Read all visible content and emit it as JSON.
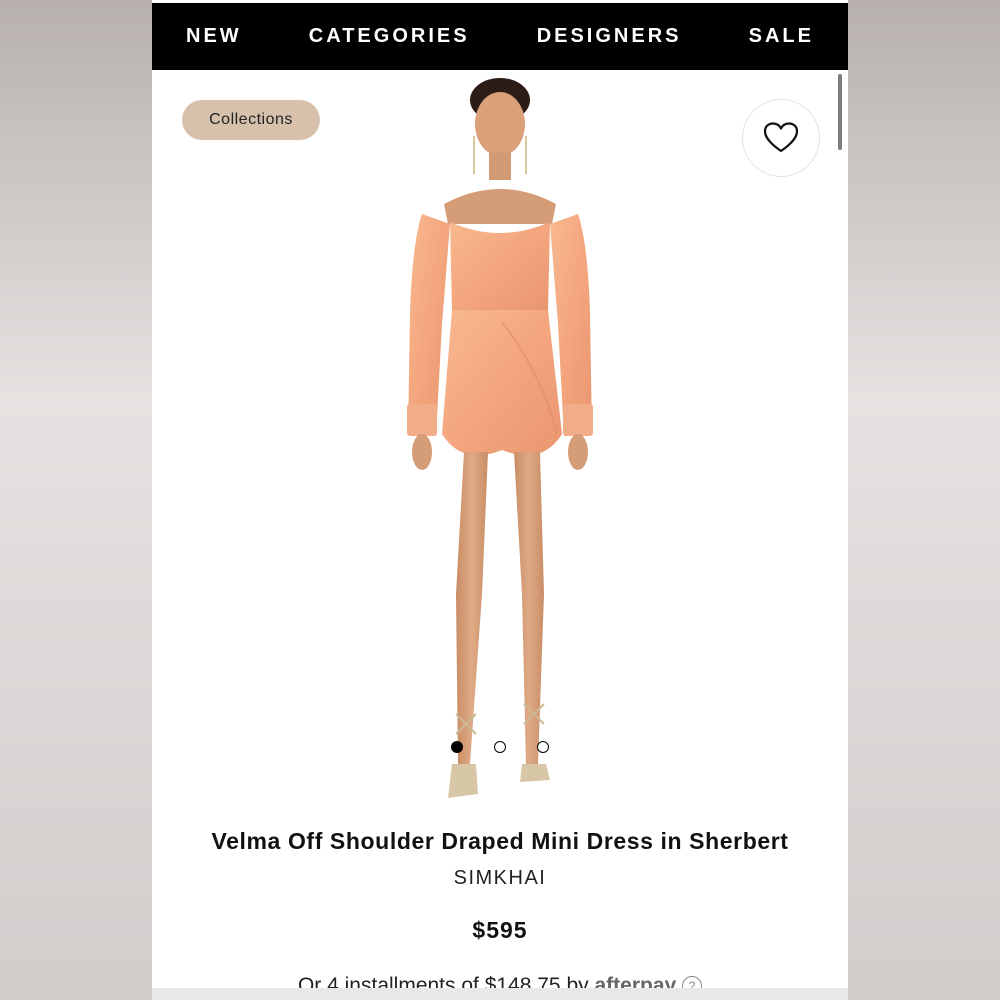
{
  "nav": {
    "items": [
      "NEW",
      "CATEGORIES",
      "DESIGNERS",
      "SALE"
    ]
  },
  "badge": {
    "label": "Collections"
  },
  "wishlist": {
    "icon": "heart-icon"
  },
  "carousel": {
    "count": 3,
    "active_index": 0
  },
  "product": {
    "title": "Velma Off Shoulder Draped Mini Dress in Sherbert",
    "brand": "SIMKHAI",
    "price": "$595",
    "installments_text": "Or 4 installments of $148.75 by",
    "installments_provider": "afterpay"
  },
  "colors": {
    "nav_bg": "#000000",
    "badge_bg": "#d7c0ac",
    "dress": "#f4a67e"
  }
}
